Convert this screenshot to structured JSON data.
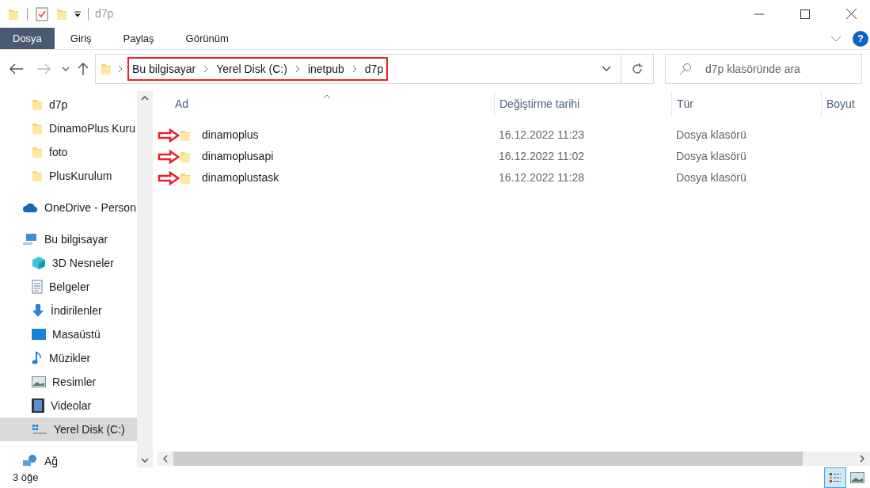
{
  "window": {
    "title": "d7p"
  },
  "ribbon_tabs": [
    {
      "label": "Dosya",
      "selected": true
    },
    {
      "label": "Giriş",
      "selected": false
    },
    {
      "label": "Paylaş",
      "selected": false
    },
    {
      "label": "Görünüm",
      "selected": false
    }
  ],
  "help": {
    "label": "?"
  },
  "breadcrumb": {
    "annotated": true,
    "segments": [
      "Bu bilgisayar",
      "Yerel Disk (C:)",
      "inetpub",
      "d7p"
    ]
  },
  "search": {
    "placeholder": "d7p klasöründe ara"
  },
  "sidebar": {
    "items": [
      {
        "label": "d7p",
        "kind": "folder",
        "selected": false
      },
      {
        "label": "DinamoPlus Kuru",
        "kind": "folder",
        "selected": false
      },
      {
        "label": "foto",
        "kind": "folder",
        "selected": false
      },
      {
        "label": "PlusKurulum",
        "kind": "folder",
        "selected": false
      },
      {
        "label": "OneDrive - Person",
        "kind": "cloud",
        "selected": false,
        "top": true
      },
      {
        "label": "Bu bilgisayar",
        "kind": "pc",
        "selected": false,
        "top": true,
        "children": [
          {
            "label": "3D Nesneler",
            "kind": "cube",
            "selected": false
          },
          {
            "label": "Belgeler",
            "kind": "document",
            "selected": false
          },
          {
            "label": "İndirilenler",
            "kind": "download",
            "selected": false
          },
          {
            "label": "Masaüstü",
            "kind": "desktop",
            "selected": false
          },
          {
            "label": "Müzikler",
            "kind": "music",
            "selected": false
          },
          {
            "label": "Resimler",
            "kind": "picture",
            "selected": false
          },
          {
            "label": "Videolar",
            "kind": "video",
            "selected": false
          },
          {
            "label": "Yerel Disk (C:)",
            "kind": "drive",
            "selected": true
          }
        ]
      },
      {
        "label": "Ağ",
        "kind": "network",
        "selected": false,
        "top": true
      }
    ]
  },
  "table": {
    "columns": [
      "Ad",
      "Değiştirme tarihi",
      "Tür",
      "Boyut"
    ],
    "rows": [
      {
        "name": "dinamoplus",
        "modified": "16.12.2022 11:23",
        "type": "Dosya klasörü",
        "arrow": true
      },
      {
        "name": "dinamoplusapi",
        "modified": "16.12.2022 11:02",
        "type": "Dosya klasörü",
        "arrow": true
      },
      {
        "name": "dinamoplustask",
        "modified": "16.12.2022 11:28",
        "type": "Dosya klasörü",
        "arrow": true
      }
    ]
  },
  "status_bar": {
    "count": "3 öğe"
  }
}
